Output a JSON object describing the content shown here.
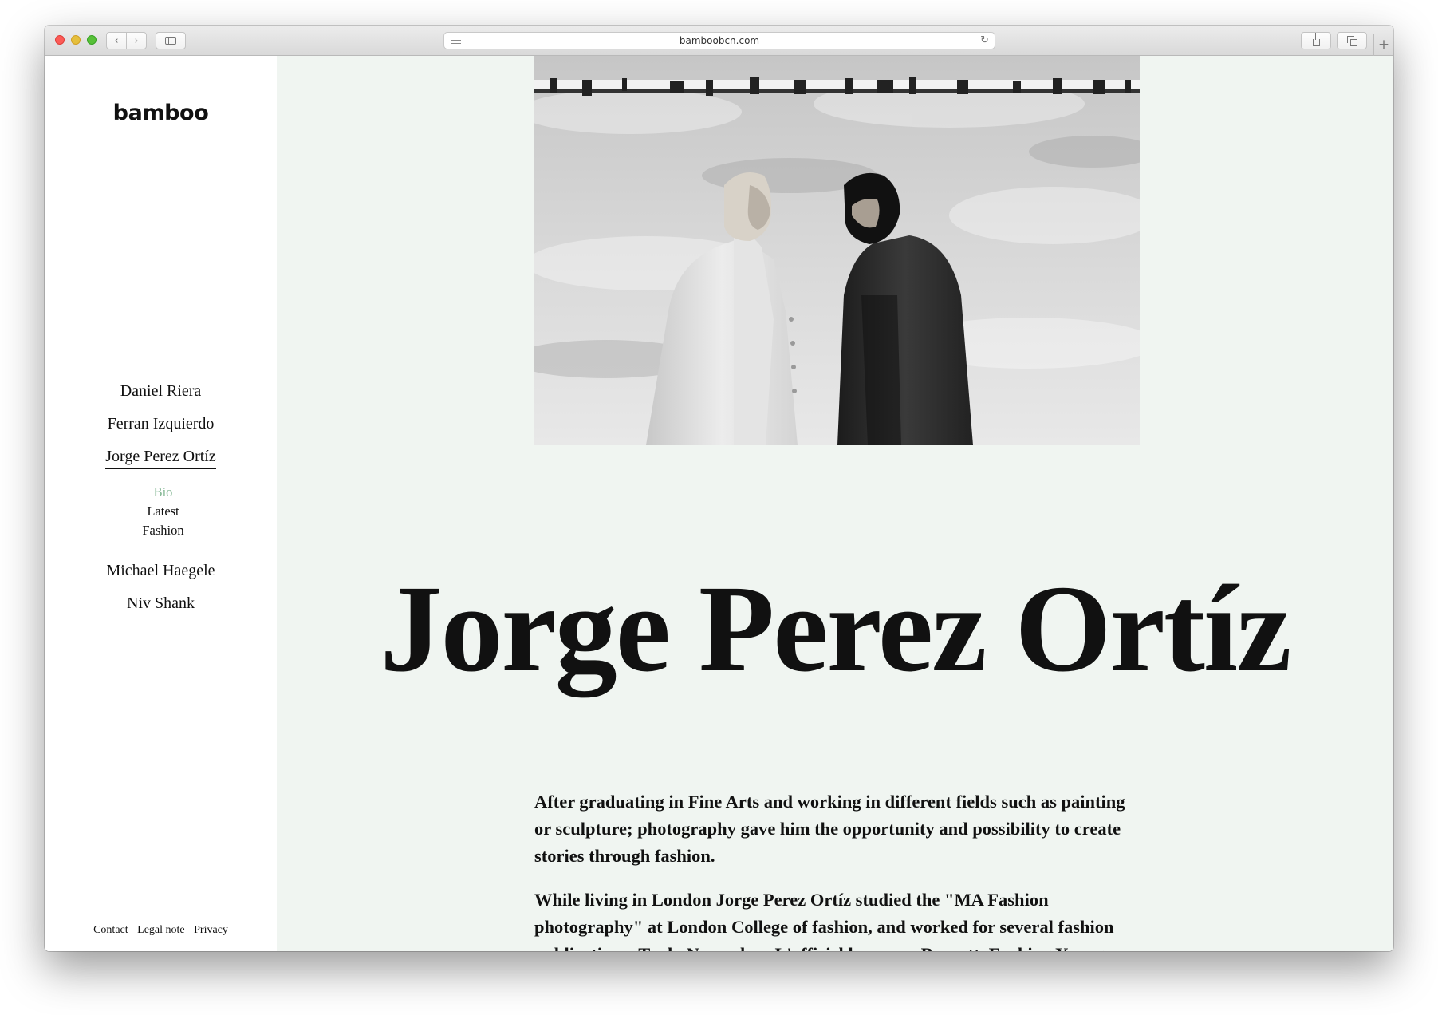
{
  "browser": {
    "url": "bamboobcn.com",
    "back_icon": "‹",
    "forward_icon": "›",
    "reload_icon": "↻",
    "new_tab_icon": "+"
  },
  "site": {
    "logo": "bamboo",
    "nav": {
      "items_before": [
        {
          "label": "Daniel Riera"
        },
        {
          "label": "Ferran Izquierdo"
        }
      ],
      "active": "Jorge Perez Ortíz",
      "subitems": [
        "Bio",
        "Latest",
        "Fashion"
      ],
      "current_subitem": "Bio",
      "items_after": [
        {
          "label": "Michael Haegele"
        },
        {
          "label": "Niv Shank"
        }
      ]
    },
    "footer": [
      "Contact",
      "Legal note",
      "Privacy"
    ]
  },
  "main": {
    "title": "Jorge Perez Ortíz",
    "bio": [
      "After graduating in Fine Arts and working in different fields such as painting or sculpture; photography gave him the opportunity and possibility to create stories through fashion.",
      "While living in London Jorge Perez Ortíz studied the \"MA Fashion photography\" at London College of fashion, and worked for several fashion publications: Tank, Novembre, L'officiel hommes, Boycott, Fucking Young"
    ]
  },
  "colors": {
    "main_bg": "#f0f5f1",
    "subnav_current": "#86b896",
    "text": "#111111"
  }
}
